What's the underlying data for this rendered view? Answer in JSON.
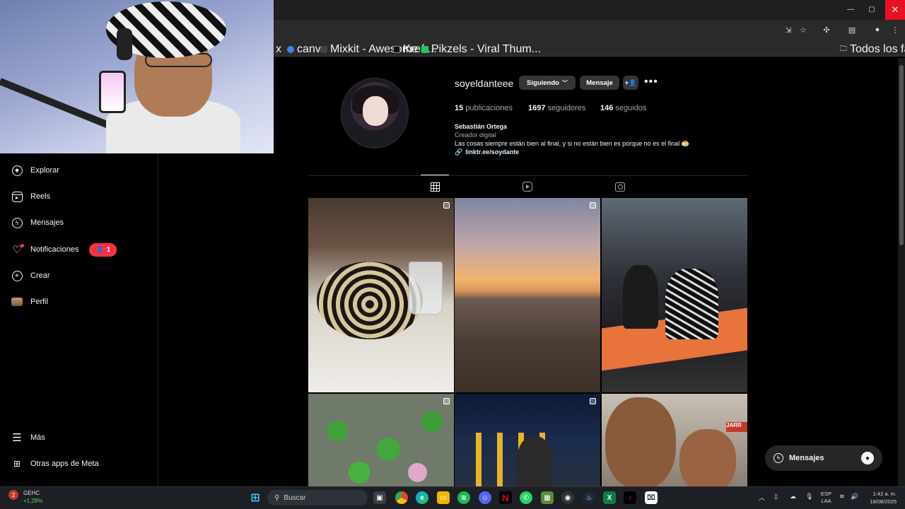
{
  "browser": {
    "window_controls": {
      "minimize": "—",
      "restore": "▢",
      "close": "✕"
    },
    "bookmarks": [
      {
        "label": "x"
      },
      {
        "label": "canva",
        "color": "#3b82f6"
      },
      {
        "label": "Mixkit - Awesome fr...",
        "color": "#444444"
      },
      {
        "label": "Krea",
        "color": "#111111"
      },
      {
        "label": "Pikzels - Viral Thum...",
        "color": "#22c55e"
      }
    ],
    "all_favorites": "Todos los favoritos"
  },
  "sidebar": {
    "items": [
      {
        "label": "Explorar",
        "icon": "compass-icon"
      },
      {
        "label": "Reels",
        "icon": "reels-icon"
      },
      {
        "label": "Mensajes",
        "icon": "messenger-icon"
      },
      {
        "label": "Notificaciones",
        "icon": "heart-icon"
      },
      {
        "label": "Crear",
        "icon": "plus-square-icon"
      },
      {
        "label": "Perfil",
        "icon": "avatar-icon"
      }
    ],
    "notif_badge": "1",
    "more": "Más",
    "meta_apps": "Otras apps de Meta"
  },
  "profile": {
    "username": "soyeldanteee",
    "following_btn": "Siguiendo",
    "message_btn": "Mensaje",
    "stats": {
      "posts": {
        "count": "15",
        "label": "publicaciones"
      },
      "followers": {
        "count": "1697",
        "label": "seguidores"
      },
      "following": {
        "count": "146",
        "label": "seguidos"
      }
    },
    "full_name": "Sebastián Ortega",
    "category": "Creador digital",
    "bio": "Las cosas siempre están bien al final, y si no están bien es porque no es el final 🍮",
    "link": "linktr.ee/soydante"
  },
  "posts": {
    "post6_sign": "JARR"
  },
  "messages_bar": {
    "label": "Mensajes"
  },
  "taskbar": {
    "widget_name": "GEHC",
    "widget_value": "+1,28%",
    "search_placeholder": "Buscar",
    "lang_top": "ESP",
    "lang_bottom": "LAA",
    "time": "1:42 a. m.",
    "date": "18/08/2025"
  },
  "colors": {
    "accent_red": "#ff3040",
    "close_red": "#e81123",
    "button_gray": "#363636"
  }
}
